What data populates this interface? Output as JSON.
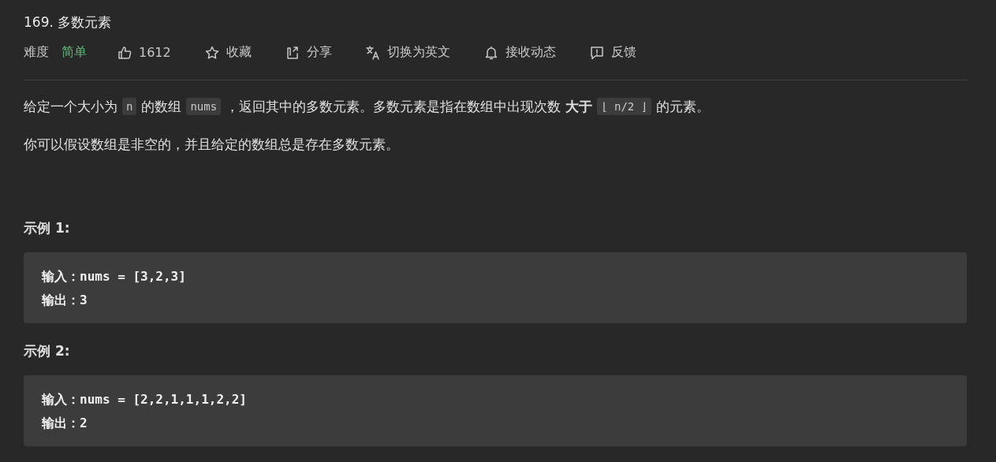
{
  "title": "169. 多数元素",
  "meta": {
    "difficulty_label": "难度",
    "difficulty": "简单",
    "actions": [
      {
        "label": "1612"
      },
      {
        "label": "收藏"
      },
      {
        "label": "分享"
      },
      {
        "label": "切换为英文"
      },
      {
        "label": "接收动态"
      },
      {
        "label": "反馈"
      }
    ]
  },
  "description": [
    [
      {
        "kind": "text",
        "text": "给定一个大小为"
      },
      {
        "kind": "code",
        "text": "n"
      },
      {
        "kind": "text",
        "text": "的数组"
      },
      {
        "kind": "code",
        "text": "nums"
      },
      {
        "kind": "text",
        "text": "，返回其中的多数元素。多数元素是指在数组中出现次数"
      },
      {
        "kind": "bold",
        "text": "大于"
      },
      {
        "kind": "code",
        "text": "⌊ n/2 ⌋"
      },
      {
        "kind": "text",
        "text": "的元素。"
      }
    ],
    [
      {
        "kind": "text",
        "text": "你可以假设数组是非空的，并且给定的数组总是存在多数元素。"
      }
    ]
  ],
  "examples": [
    {
      "heading": "示例 1:",
      "lines": [
        "输入：nums = [3,2,3]",
        "输出：3"
      ]
    },
    {
      "heading": "示例 2:",
      "lines": [
        "输入：nums = [2,2,1,1,1,2,2]",
        "输出：2"
      ]
    }
  ]
}
